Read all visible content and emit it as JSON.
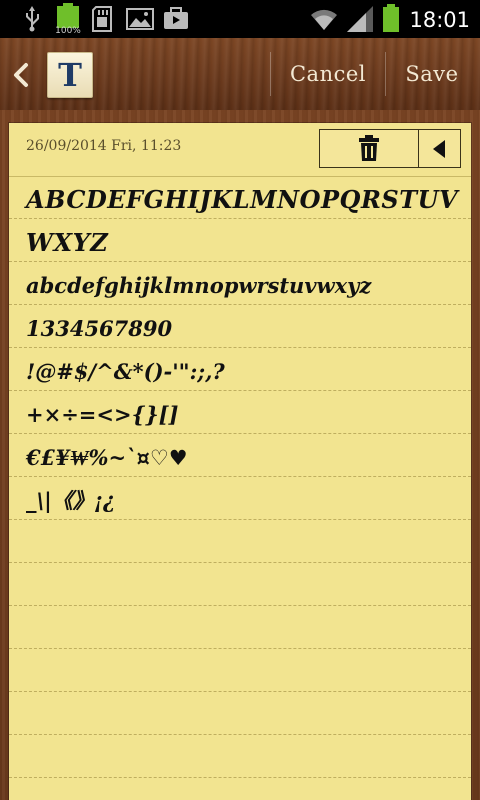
{
  "status_bar": {
    "time": "18:01",
    "battery_label": "100%",
    "icons": [
      "usb-icon",
      "battery-full-icon",
      "sd-card-icon",
      "gallery-icon",
      "store-bag-icon",
      "wifi-icon",
      "signal-icon",
      "battery-charging-icon"
    ]
  },
  "action_bar": {
    "back_icon": "chevron-left-icon",
    "app_icon_letter": "T",
    "cancel_label": "Cancel",
    "save_label": "Save"
  },
  "note": {
    "date": "26/09/2014 Fri, 11:23",
    "tools": [
      "trash-icon",
      "collapse-left-icon"
    ],
    "lines": [
      "ABCDEFGHIJKLMNOPQRSTUV",
      "WXYZ",
      "abcdefghijklmnopwrstuvwxyz",
      "1334567890",
      "!@#$/^&*()-'\":;,?",
      "+×÷=<>{}[]",
      "€£¥₩%~`¤♡♥",
      "_\\|《》¡¿",
      "",
      "",
      "",
      "",
      "",
      "",
      ""
    ]
  },
  "colors": {
    "paper": "#f2e490",
    "wood": "#6b3a1d",
    "ink": "#111111"
  }
}
